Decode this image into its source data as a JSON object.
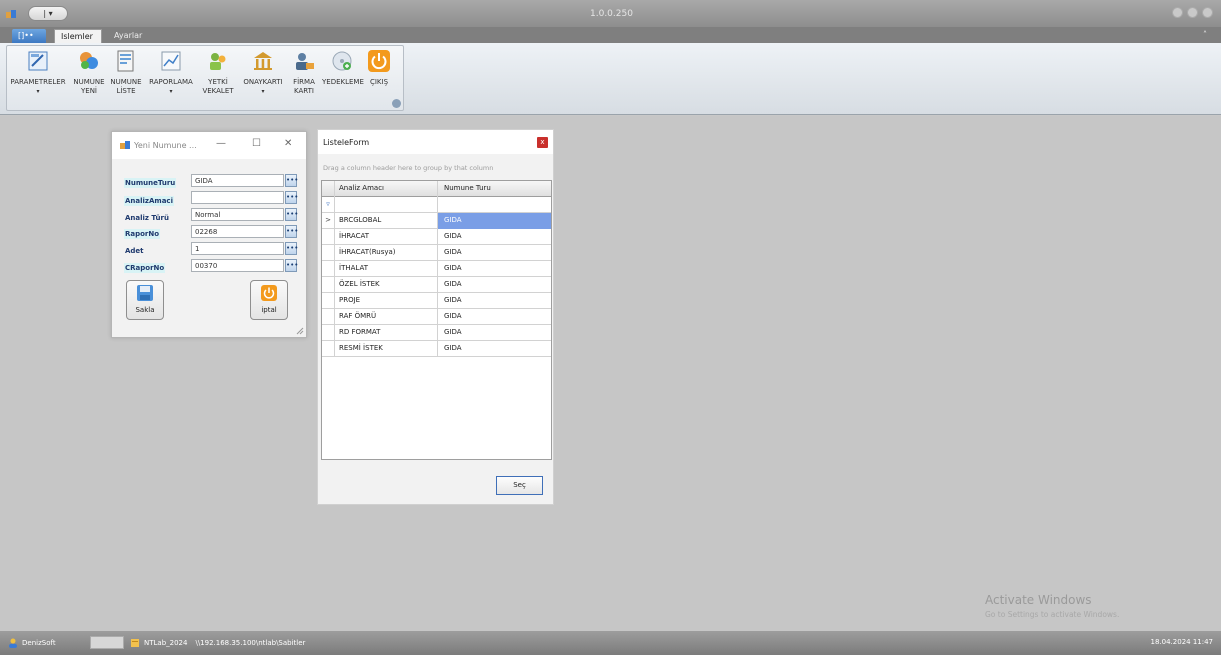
{
  "app": {
    "version": "1.0.0.250"
  },
  "quick_access": {
    "label": "| ▾"
  },
  "tabs": {
    "file": "[]••",
    "islemler": "Islemler",
    "ayarlar": "Ayarlar",
    "minimize": "˄"
  },
  "ribbon": {
    "buttons": [
      {
        "line1": "PARAMETRELER",
        "line2": "",
        "has_arrow": true
      },
      {
        "line1": "NUMUNE",
        "line2": "YENİ",
        "has_arrow": false
      },
      {
        "line1": "NUMUNE",
        "line2": "LİSTE",
        "has_arrow": false
      },
      {
        "line1": "RAPORLAMA",
        "line2": "",
        "has_arrow": true
      },
      {
        "line1": "YETKİ",
        "line2": "VEKALET",
        "has_arrow": false
      },
      {
        "line1": "ONAYKARTI",
        "line2": "",
        "has_arrow": true
      },
      {
        "line1": "FİRMA",
        "line2": "KARTI",
        "has_arrow": false
      },
      {
        "line1": "YEDEKLEME",
        "line2": "",
        "has_arrow": false
      },
      {
        "line1": "ÇIKIŞ",
        "line2": "",
        "has_arrow": false
      }
    ]
  },
  "new_sample_dialog": {
    "title": "Yeni Numune ...",
    "ctrl_min": "—",
    "ctrl_max": "☐",
    "ctrl_close": "✕",
    "fields": [
      {
        "label": "NumuneTuru",
        "value": "GIDA",
        "highlight": true
      },
      {
        "label": "AnalizAmaci",
        "value": "",
        "highlight": true
      },
      {
        "label": "Analiz Türü",
        "value": "Normal",
        "highlight": false
      },
      {
        "label": "RaporNo",
        "value": "02268",
        "highlight": true
      },
      {
        "label": "Adet",
        "value": "1",
        "highlight": false
      },
      {
        "label": "CRaporNo",
        "value": "00370",
        "highlight": true
      }
    ],
    "ellipsis": "•••",
    "save_label": "Sakla",
    "cancel_label": "iptal"
  },
  "list_form": {
    "title": "ListeleForm",
    "close": "x",
    "group_hint": "Drag a column header here to group by that column",
    "columns": [
      "Analiz Amacı",
      "Numune Turu"
    ],
    "filter_icon": "▿",
    "rows": [
      {
        "indicator": ">",
        "analiz_amaci": "BRCGLOBAL",
        "numune_turu": "GIDA",
        "selected": true
      },
      {
        "indicator": "",
        "analiz_amaci": "İHRACAT",
        "numune_turu": "GIDA",
        "selected": false
      },
      {
        "indicator": "",
        "analiz_amaci": "İHRACAT(Rusya)",
        "numune_turu": "GIDA",
        "selected": false
      },
      {
        "indicator": "",
        "analiz_amaci": "İTHALAT",
        "numune_turu": "GIDA",
        "selected": false
      },
      {
        "indicator": "",
        "analiz_amaci": "ÖZEL İSTEK",
        "numune_turu": "GIDA",
        "selected": false
      },
      {
        "indicator": "",
        "analiz_amaci": "PROJE",
        "numune_turu": "GIDA",
        "selected": false
      },
      {
        "indicator": "",
        "analiz_amaci": "RAF ÖMRÜ",
        "numune_turu": "GIDA",
        "selected": false
      },
      {
        "indicator": "",
        "analiz_amaci": "RD FORMAT",
        "numune_turu": "GIDA",
        "selected": false
      },
      {
        "indicator": "",
        "analiz_amaci": "RESMİ İSTEK",
        "numune_turu": "GIDA",
        "selected": false
      }
    ],
    "select_label": "Seç"
  },
  "watermark": {
    "title": "Activate Windows",
    "subtitle": "Go to Settings to activate Windows."
  },
  "status": {
    "user": "DenizSoft",
    "db": "NTLab_2024",
    "path": "\\\\192.168.35.100\\ntlab\\Sabitler",
    "datetime": "18.04.2024 11:47"
  },
  "colors": {
    "selected_cell": "#7a9ee6",
    "label_text": "#1f3a6e",
    "label_highlight": "#d8f3f5",
    "close_red": "#c9302c"
  },
  "icons": [
    "parameters-icon",
    "new-sample-icon",
    "sample-list-icon",
    "reports-icon",
    "authority-icon",
    "approval-card-icon",
    "company-card-icon",
    "backup-icon",
    "exit-icon",
    "save-icon",
    "cancel-icon"
  ]
}
